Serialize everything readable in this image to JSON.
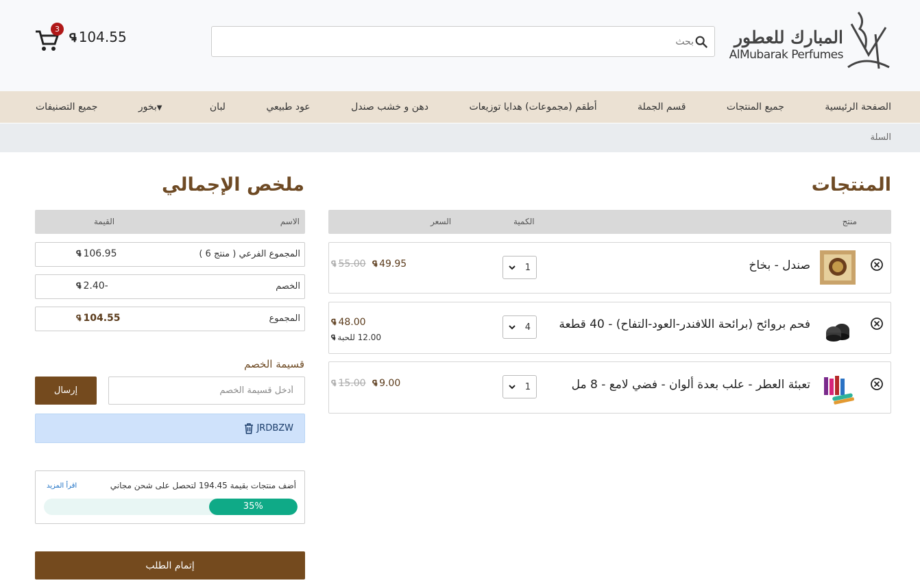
{
  "header": {
    "logo_arabic": "المبارك للعطور",
    "logo_english": "AlMubarak Perfumes",
    "search_placeholder": "بحث",
    "cart_total": "104.55",
    "cart_count": "3",
    "currency_symbol": "⃁"
  },
  "nav": {
    "items": [
      "الصفحة الرئيسية",
      "جميع المنتجات",
      "قسم الجملة",
      "أطقم (مجموعات) هدايا توزيعات",
      "دهن و خشب صندل",
      "عود طبيعي",
      "لبان",
      "بخور",
      "جميع التصنيفات"
    ]
  },
  "breadcrumb": {
    "current": "السلة"
  },
  "products": {
    "title": "المنتجات",
    "columns": {
      "product": "منتج",
      "quantity": "الكمية",
      "price": "السعر"
    },
    "items": [
      {
        "name": "صندل - بخاخ",
        "qty": "1",
        "price": "49.95",
        "old_price": "55.00",
        "unit_price": ""
      },
      {
        "name": "فحم بروائح (برائحة اللافندر-العود-التفاح) - 40 قطعة",
        "qty": "4",
        "price": "48.00",
        "old_price": "",
        "unit_price": "12.00 للحبة"
      },
      {
        "name": "تعبئة العطر - علب بعدة ألوان - فضي لامع - 8 مل",
        "qty": "1",
        "price": "9.00",
        "old_price": "15.00",
        "unit_price": ""
      }
    ]
  },
  "summary": {
    "title": "ملخص الإجمالي",
    "columns": {
      "name": "الاسم",
      "value": "القيمة"
    },
    "subtotal_label": "المجموع الفرعي ( منتج 6 )",
    "subtotal_value": "106.95",
    "discount_label": "الخصم",
    "discount_value": "-2.40",
    "total_label": "المجموع",
    "total_value": "104.55"
  },
  "coupon": {
    "label": "قسيمة الخصم",
    "placeholder": "أدخل قسيمة الخصم",
    "submit": "إرسال",
    "applied_code": "JRDBZW"
  },
  "shipping": {
    "message": "أضف منتجات بقيمة 194.45 لتحصل على شحن مجاني",
    "read_more": "اقرأ المزيد",
    "progress_percent": 35,
    "progress_label": "35%"
  },
  "checkout": {
    "label": "إتمام الطلب"
  },
  "colors": {
    "brand_brown": "#744a1e",
    "heading": "#6e4a24",
    "nav_bg": "#ebe1d3",
    "progress": "#0faa87",
    "badge": "#b01818"
  }
}
